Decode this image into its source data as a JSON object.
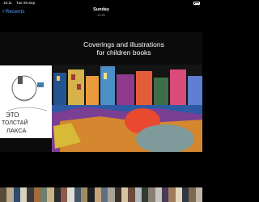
{
  "status": {
    "time": "10:11",
    "date": "Tue 29 Sep"
  },
  "nav": {
    "back_label": "Recents",
    "title": "Sunday",
    "subtitle": "17:21"
  },
  "photo": {
    "headline_line1": "Coverings and illustrations",
    "headline_line2": "for children books",
    "sketch_text": "ЭТО ТОЛСТАЙ ЛАКСА"
  },
  "filmstrip": {
    "colors": [
      "#5a4a3a",
      "#b9a98f",
      "#2d4b6e",
      "#d9d1c0",
      "#3b3b3b",
      "#a56b3b",
      "#6f7f6d",
      "#c9b48a",
      "#2b2b2b",
      "#8d5a4e",
      "#e0ddd4",
      "#445566",
      "#9e8b66",
      "#1f1f1f",
      "#c4a27a",
      "#5e6f84",
      "#a7a39a",
      "#393028",
      "#d7c2a0",
      "#6b4b3b",
      "#b2b9c1",
      "#2f3d2f",
      "#8a7f73",
      "#c8c6bf",
      "#4a3a5a",
      "#9d7b5b",
      "#e3d6bd",
      "#30373f",
      "#7e6a52",
      "#bfb7a9"
    ]
  }
}
